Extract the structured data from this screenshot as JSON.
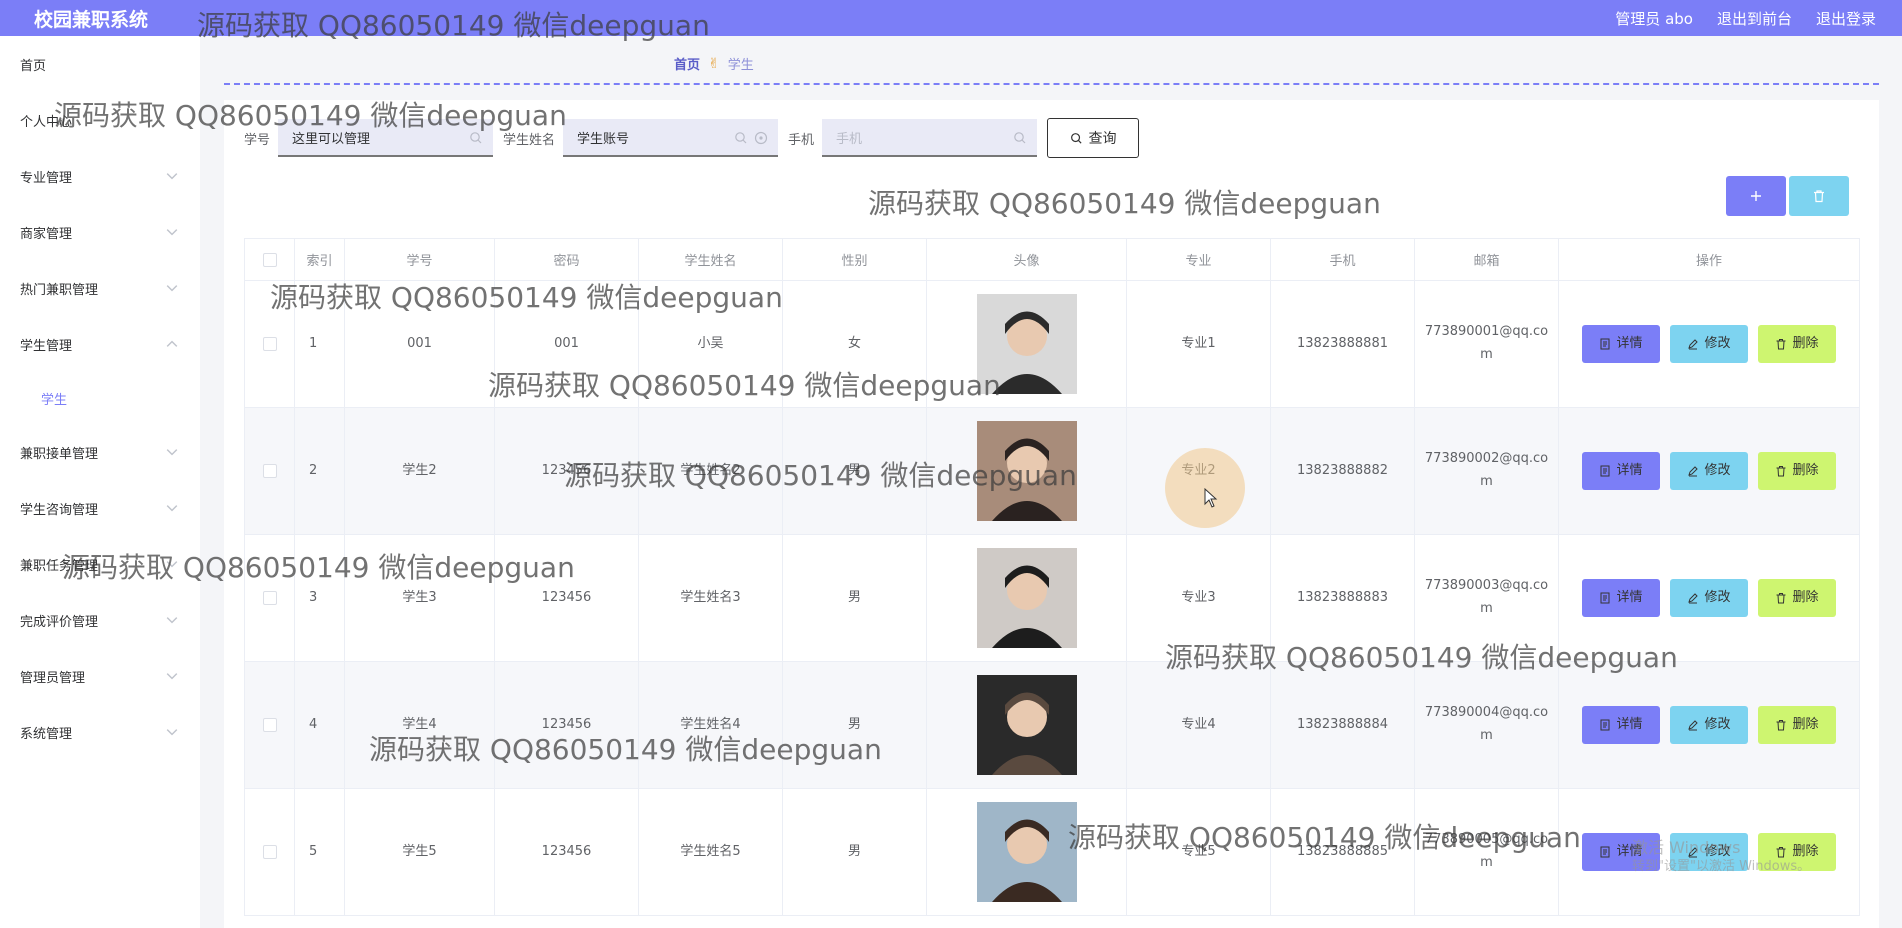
{
  "header": {
    "brand": "校园兼职系统",
    "user_label": "管理员 abo",
    "front_link": "退出到前台",
    "logout_link": "退出登录"
  },
  "sidebar": {
    "items": [
      {
        "label": "首页",
        "has_chevron": false
      },
      {
        "label": "个人中心",
        "has_chevron": false
      },
      {
        "label": "专业管理",
        "has_chevron": true
      },
      {
        "label": "商家管理",
        "has_chevron": true
      },
      {
        "label": "热门兼职管理",
        "has_chevron": true
      },
      {
        "label": "学生管理",
        "has_chevron": true
      },
      {
        "label": "学生",
        "sub": true
      },
      {
        "label": "兼职接单管理",
        "has_chevron": true
      },
      {
        "label": "学生咨询管理",
        "has_chevron": true
      },
      {
        "label": "兼职任务管理",
        "has_chevron": true
      },
      {
        "label": "完成评价管理",
        "has_chevron": true
      },
      {
        "label": "管理员管理",
        "has_chevron": true
      },
      {
        "label": "系统管理",
        "has_chevron": true
      }
    ]
  },
  "breadcrumb": {
    "home": "首页",
    "current": "学生"
  },
  "search": {
    "student_no_label": "学号",
    "student_no_value": "这里可以管理",
    "name_label": "学生姓名",
    "name_value": "学生账号",
    "phone_label": "手机",
    "phone_placeholder": "手机",
    "query_label": "查询"
  },
  "table": {
    "headers": [
      "索引",
      "学号",
      "密码",
      "学生姓名",
      "性别",
      "头像",
      "专业",
      "手机",
      "邮箱",
      "操作"
    ],
    "rows": [
      {
        "index": "1",
        "no": "001",
        "password": "001",
        "name": "小吴",
        "gender": "女",
        "major": "专业1",
        "phone": "13823888881",
        "email": "773890001@qq.com"
      },
      {
        "index": "2",
        "no": "学生2",
        "password": "123456",
        "name": "学生姓名2",
        "gender": "男",
        "major": "专业2",
        "phone": "13823888882",
        "email": "773890002@qq.com"
      },
      {
        "index": "3",
        "no": "学生3",
        "password": "123456",
        "name": "学生姓名3",
        "gender": "男",
        "major": "专业3",
        "phone": "13823888883",
        "email": "773890003@qq.com"
      },
      {
        "index": "4",
        "no": "学生4",
        "password": "123456",
        "name": "学生姓名4",
        "gender": "男",
        "major": "专业4",
        "phone": "13823888884",
        "email": "773890004@qq.com"
      },
      {
        "index": "5",
        "no": "学生5",
        "password": "123456",
        "name": "学生姓名5",
        "gender": "男",
        "major": "专业5",
        "phone": "13823888885",
        "email": "773890005@qq.com"
      }
    ],
    "op_detail": "详情",
    "op_edit": "修改",
    "op_delete": "删除"
  },
  "watermark": "源码获取 QQ86050149 微信deepguan",
  "windows_activation": {
    "line1": "激活 Windows",
    "line2": "转到\"设置\"以激活 Windows。"
  },
  "colors": {
    "accent": "#7b7ef7",
    "edit": "#7dd3f0",
    "delete": "#cef570"
  }
}
